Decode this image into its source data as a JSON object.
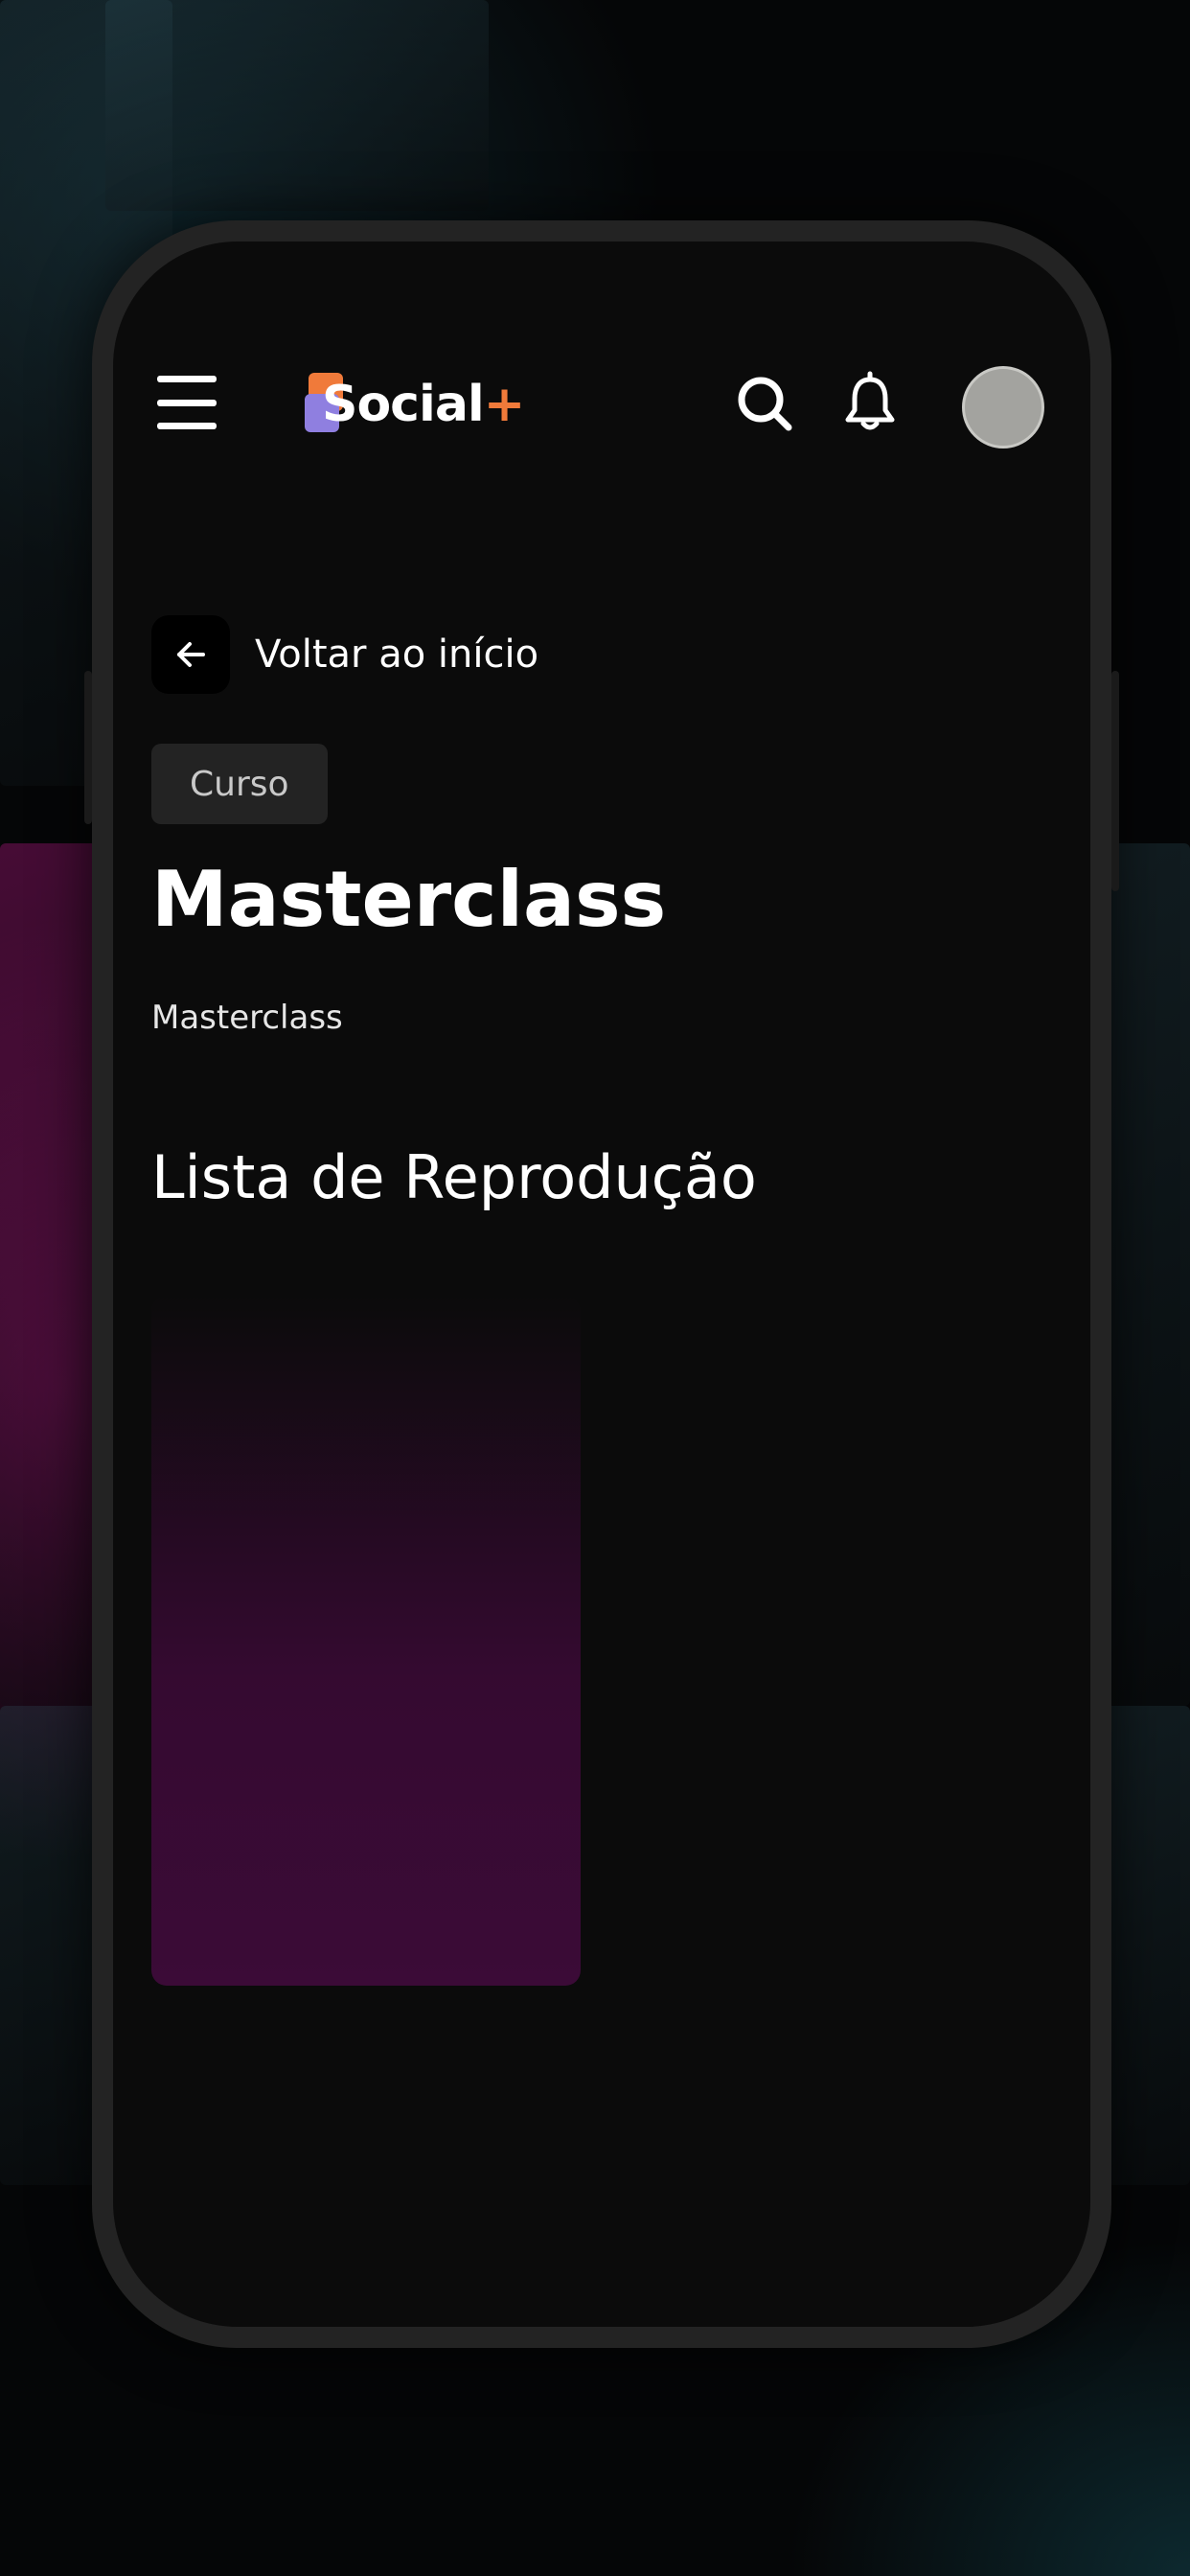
{
  "app": {
    "logo_text": "Social",
    "logo_plus": "+",
    "brand_colors": {
      "orange": "#f07a3a",
      "purple": "#8f7fe0"
    }
  },
  "header": {
    "menu_icon": "hamburger-menu-icon",
    "search_icon": "search-icon",
    "notifications_icon": "bell-icon",
    "avatar": "user-avatar"
  },
  "nav": {
    "back_label": "Voltar ao início",
    "back_icon": "arrow-left-icon"
  },
  "course": {
    "tag": "Curso",
    "title": "Masterclass",
    "description": "Masterclass"
  },
  "playlist": {
    "title": "Lista de Reprodução",
    "accent_color": "#3b0b37"
  }
}
